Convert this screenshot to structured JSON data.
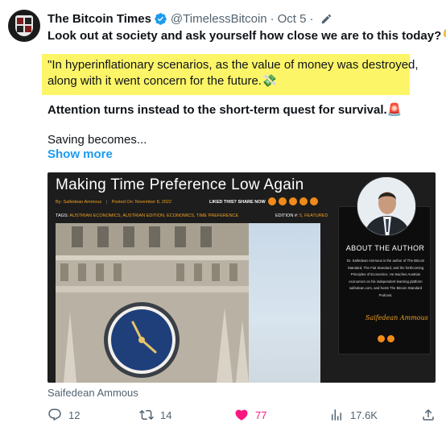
{
  "tweet": {
    "author_name": "The Bitcoin Times",
    "handle": "@TimelessBitcoin",
    "separator": "·",
    "date": "Oct 5",
    "date_separator": "·",
    "line1": "Look out at society and ask yourself how close we are to this today?",
    "line1_emoji": "👇",
    "quote_line1": "\"In hyperinflationary scenarios, as the value of money was destroyed,",
    "quote_line2": "along with it went concern for the future.",
    "quote_emoji": "💸",
    "line3": "Attention turns instead to the short-term quest for survival.",
    "line3_emoji": "🚨",
    "line4": "Saving becomes...",
    "show_more": "Show more"
  },
  "card": {
    "title": "Making Time Preference Low Again",
    "by_label": "By:",
    "author": "Saifedean Ammous",
    "posted_label": "Posted On:",
    "posted_date": "November 8, 2022",
    "share_label": "LIKED THIS? SHARE NOW",
    "tags_label": "TAGS:",
    "tags_values": "AUSTRIAN ECONOMICS, AUSTRIAN EDITION, ECONOMICS, TIME PREFERENCE",
    "edition_label": "EDITION #:",
    "edition_values": "5, FEATURED",
    "about_title": "ABOUT THE AUTHOR",
    "about_text": "Dr. Saifedean Ammous is the author of The Bitcoin Standard, The Fiat Standard, and the forthcoming Principles of Economics. He teaches Austrian economics on his independent learning platform saifedean.com, and hosts The Bitcoin Standard Podcast.",
    "signature": "Saifedean Ammous",
    "caption": "Saifedean Ammous",
    "accent_color": "#f08a1a"
  },
  "actions": {
    "replies": "12",
    "retweets": "14",
    "likes": "77",
    "views": "17.6K"
  },
  "colors": {
    "text": "#0f1419",
    "secondary": "#536471",
    "link": "#1d9bf0",
    "highlight": "#fdf568",
    "like": "#f91880",
    "verified": "#1d9bf0"
  }
}
